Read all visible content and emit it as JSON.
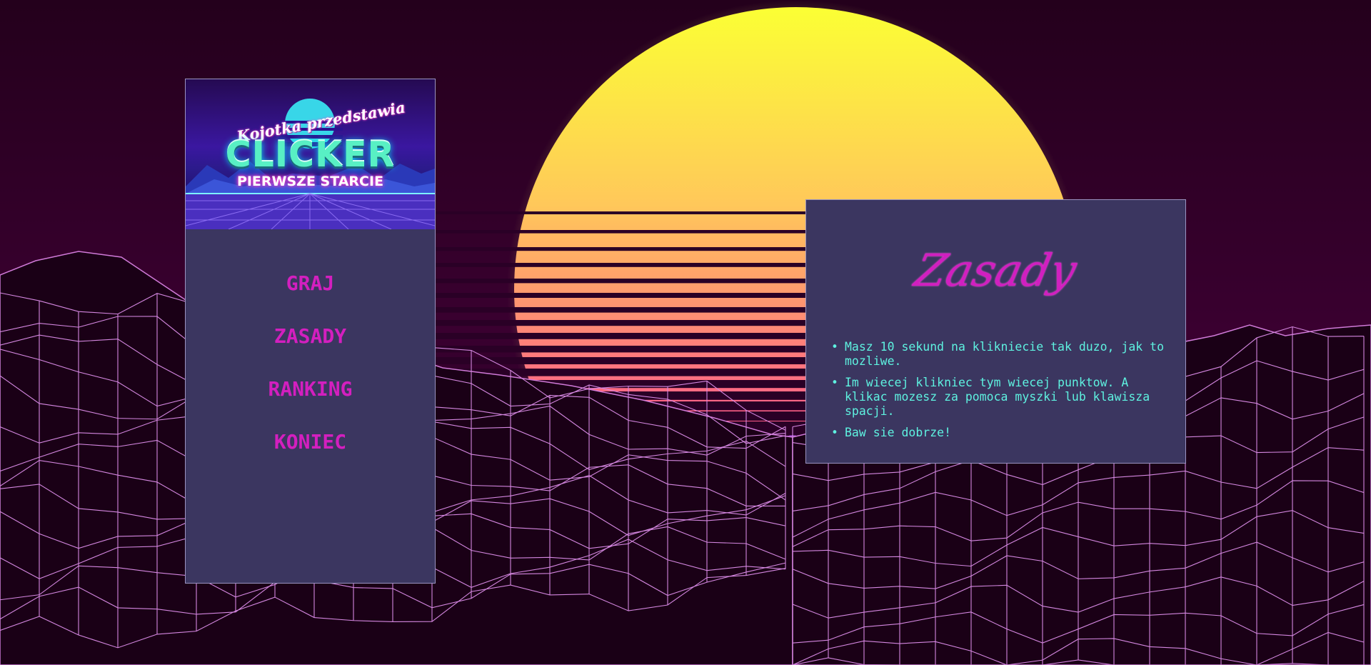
{
  "banner": {
    "script_text": "Kojotka przedstawia",
    "title": "CLICKER",
    "subtitle": "PIERWSZE STARCIE"
  },
  "menu": {
    "items": [
      {
        "label": "GRAJ"
      },
      {
        "label": "ZASADY"
      },
      {
        "label": "RANKING"
      },
      {
        "label": "KONIEC"
      }
    ]
  },
  "rules": {
    "title": "Zasady",
    "items": [
      "Masz 10 sekund na klikniecie tak duzo, jak to mozliwe.",
      "Im wiecej klikniec tym wiecej punktow. A klikac mozesz za pomoca myszki lub klawisza spacji.",
      "Baw sie dobrze!"
    ]
  },
  "colors": {
    "panel_bg": "#3b3660",
    "menu_text": "#d31fbf",
    "rules_title": "#d11fc0",
    "rules_text": "#5ef2e0",
    "sky": "#26001f",
    "grid": "#c060ff"
  }
}
